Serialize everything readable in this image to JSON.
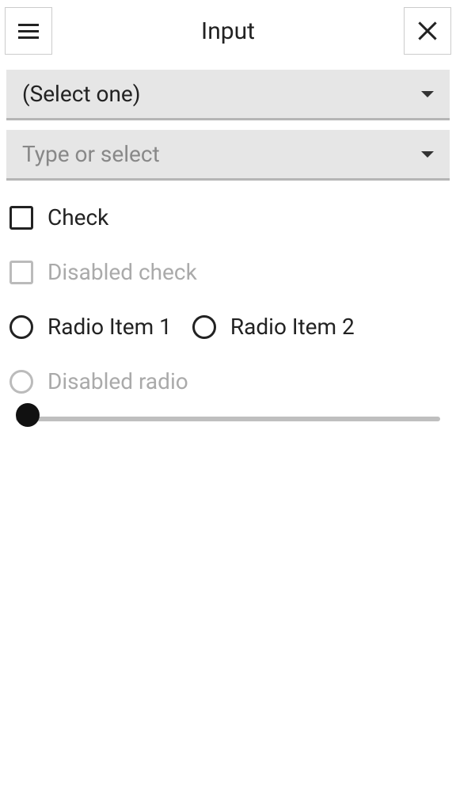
{
  "header": {
    "title": "Input"
  },
  "select1": {
    "value": "(Select one)"
  },
  "select2": {
    "placeholder": "Type or select"
  },
  "checkbox1": {
    "label": "Check"
  },
  "checkbox2": {
    "label": "Disabled check"
  },
  "radio1": {
    "label": "Radio Item 1"
  },
  "radio2": {
    "label": "Radio Item 2"
  },
  "radio3": {
    "label": "Disabled radio"
  },
  "slider": {
    "value": 0,
    "min": 0,
    "max": 100
  }
}
